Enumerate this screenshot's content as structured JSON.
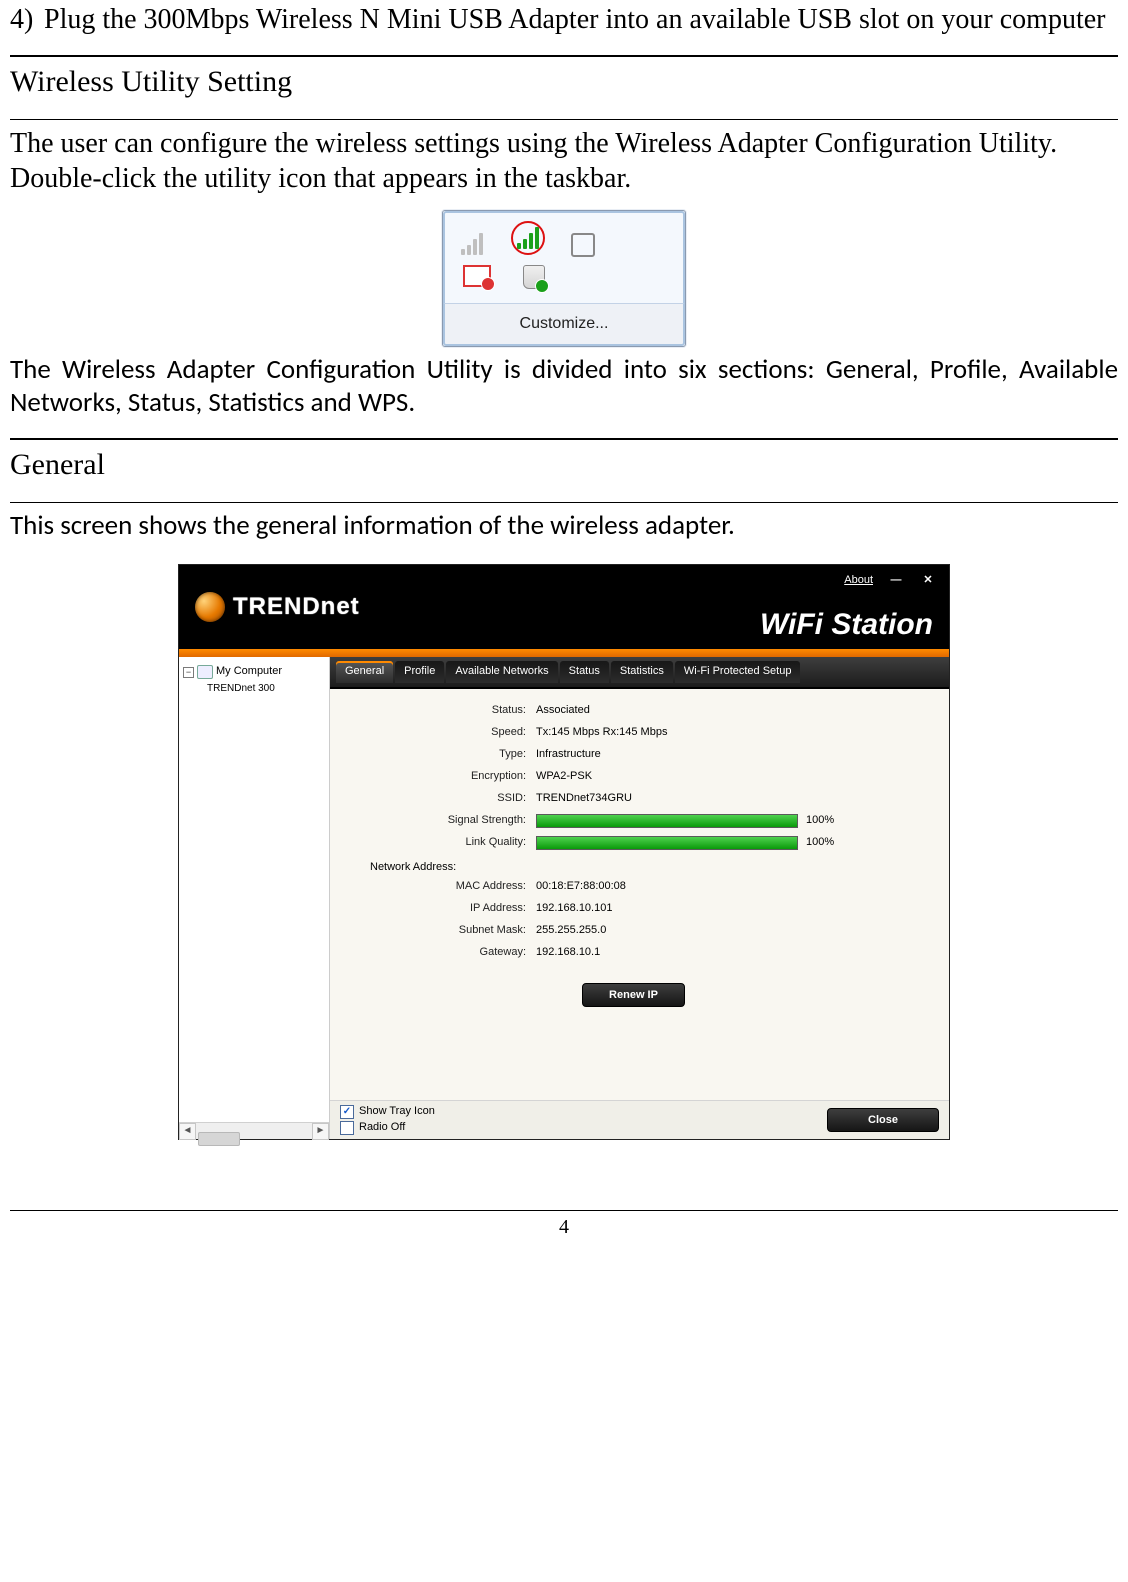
{
  "step4": {
    "num": "4)",
    "text": "Plug the 300Mbps Wireless N Mini USB Adapter into an available USB slot on your computer"
  },
  "section1": {
    "heading": "Wireless Utility Setting",
    "p1": "The user can configure the wireless settings using the Wireless Adapter Configuration Utility.  Double-click the utility icon that appears in the taskbar.",
    "p2": "The Wireless Adapter Configuration Utility is divided into six sections: General, Profile, Available Networks, Status, Statistics and WPS."
  },
  "tray": {
    "customize": "Customize...",
    "icons": {
      "signal_gray": "signal-bars-icon",
      "signal_green": "signal-bars-green-icon",
      "plug": "power-plug-icon",
      "flag": "action-center-flag-icon",
      "shield": "device-ok-icon"
    }
  },
  "section2": {
    "heading": "General",
    "p1": "This screen shows the general information of the wireless adapter."
  },
  "app": {
    "brand_up": "TREND",
    "brand_low": "NET",
    "title": "WiFi Station",
    "about": "About",
    "min": "—",
    "close": "✕",
    "tree": {
      "root": "My Computer",
      "child": "TRENDnet 300"
    },
    "tabs": [
      "General",
      "Profile",
      "Available Networks",
      "Status",
      "Statistics",
      "Wi-Fi Protected Setup"
    ],
    "active_tab": 0,
    "fields": {
      "Status": "Associated",
      "Speed": "Tx:145 Mbps  Rx:145 Mbps",
      "Type": "Infrastructure",
      "Encryption": "WPA2-PSK",
      "SSID": "TRENDnet734GRU",
      "Signal_Strength_pct": "100%",
      "Link_Quality_pct": "100%"
    },
    "netaddr_label": "Network Address:",
    "netaddr": {
      "MAC Address": "00:18:E7:88:00:08",
      "IP Address": "192.168.10.101",
      "Subnet Mask": "255.255.255.0",
      "Gateway": "192.168.10.1"
    },
    "labels": {
      "status": "Status:",
      "speed": "Speed:",
      "type": "Type:",
      "encryption": "Encryption:",
      "ssid": "SSID:",
      "signal": "Signal Strength:",
      "link": "Link Quality:",
      "mac": "MAC Address:",
      "ip": "IP Address:",
      "subnet": "Subnet Mask:",
      "gateway": "Gateway:"
    },
    "renew_btn": "Renew IP",
    "close_btn": "Close",
    "show_tray": "Show Tray Icon",
    "show_tray_checked": true,
    "radio_off": "Radio Off",
    "radio_off_checked": false
  },
  "page_number": "4"
}
